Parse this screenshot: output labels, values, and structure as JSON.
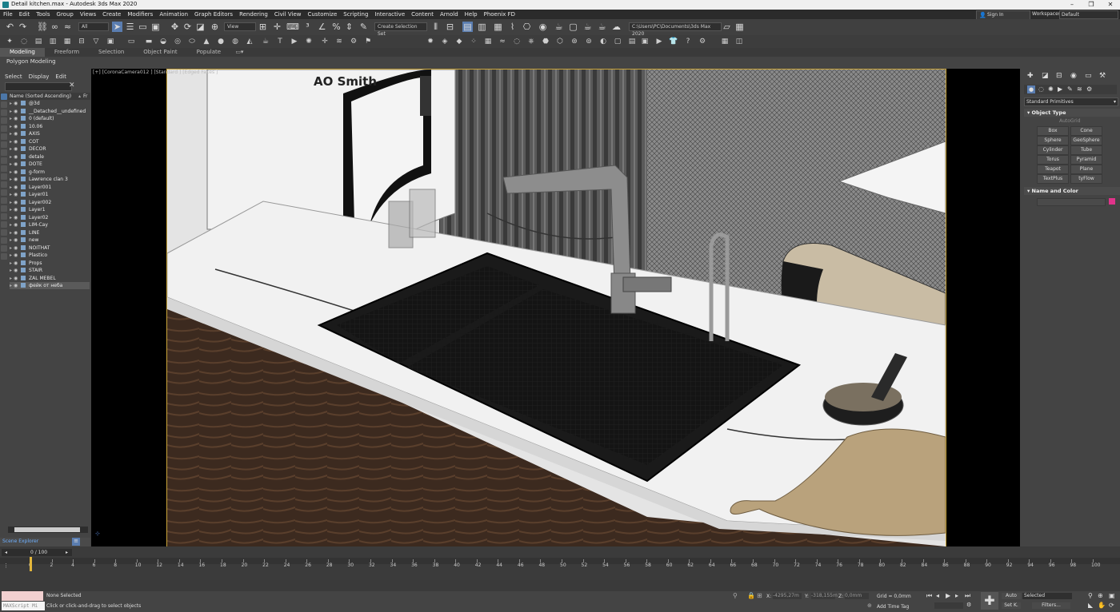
{
  "window": {
    "title": "Detail kitchen.max - Autodesk 3ds Max 2020"
  },
  "menubar": {
    "items": [
      "File",
      "Edit",
      "Tools",
      "Group",
      "Views",
      "Create",
      "Modifiers",
      "Animation",
      "Graph Editors",
      "Rendering",
      "Civil View",
      "Customize",
      "Scripting",
      "Interactive",
      "Content",
      "Arnold",
      "Help",
      "Phoenix FD"
    ],
    "sign_in": "Sign In",
    "workspaces_label": "Workspaces:",
    "workspace_value": "Default"
  },
  "toolbar": {
    "filter_value": "All",
    "view_value": "View",
    "selection_set": "Create Selection Set",
    "path": "C:\\Users\\PC\\Documents\\3ds Max 2020"
  },
  "ribbon": {
    "tabs": [
      "Modeling",
      "Freeform",
      "Selection",
      "Object Paint",
      "Populate"
    ],
    "sub_label": "Polygon Modeling"
  },
  "scene_explorer": {
    "menu": [
      "Select",
      "Display",
      "Edit"
    ],
    "column_header": "Name (Sorted Ascending)",
    "column_extra": "Fr",
    "layers": [
      "@3d",
      "__Detached__undefined",
      "0 (default)",
      "10.06",
      "AXIS",
      "COT",
      "DECOR",
      "detale",
      "DOTE",
      "g-form",
      "Lawrence clan 3",
      "Layer001",
      "Layer01",
      "Layer002",
      "Layer1",
      "Layer02",
      "LIM-Cay",
      "LINE",
      "new",
      "NOITHAT",
      "Plastico",
      "Props",
      "STAIR",
      "ZAL MEBEL",
      "фейк от неба"
    ],
    "footer_label": "Scene Explorer"
  },
  "viewport": {
    "label": "[+] [CoronaCamera012 ] [Standard ] [Edged Faces ]",
    "brand_logo": "AO Smith"
  },
  "command_panel": {
    "dropdown": "Standard Primitives",
    "object_type_header": "Object Type",
    "autogrid": "AutoGrid",
    "buttons": [
      "Box",
      "Cone",
      "Sphere",
      "GeoSphere",
      "Cylinder",
      "Tube",
      "Torus",
      "Pyramid",
      "Teapot",
      "Plane",
      "TextPlus",
      "tyFlow"
    ],
    "name_color_header": "Name and Color",
    "object_color": "#e0338a"
  },
  "timeline": {
    "frame_counter": "0 / 100",
    "ticks": [
      "0",
      "2",
      "4",
      "6",
      "8",
      "10",
      "12",
      "14",
      "16",
      "18",
      "20",
      "22",
      "24",
      "26",
      "28",
      "30",
      "32",
      "34",
      "36",
      "38",
      "40",
      "42",
      "44",
      "46",
      "48",
      "50",
      "52",
      "54",
      "56",
      "58",
      "60",
      "62",
      "64",
      "66",
      "68",
      "70",
      "72",
      "74",
      "76",
      "78",
      "80",
      "82",
      "84",
      "86",
      "88",
      "90",
      "92",
      "94",
      "96",
      "98",
      "100"
    ]
  },
  "status": {
    "script_label": "MAXScript Mi",
    "selection": "None Selected",
    "prompt": "Click or click-and-drag to select objects",
    "x_label": "X:",
    "x_value": "-4295,27m",
    "y_label": "Y:",
    "y_value": "-318,155m",
    "z_label": "Z:",
    "z_value": "0,0mm",
    "grid": "Grid = 0,0mm",
    "add_time_tag": "Add Time Tag",
    "auto": "Auto",
    "set_key": "Set K.",
    "selected": "Selected",
    "filters": "Filters..."
  }
}
